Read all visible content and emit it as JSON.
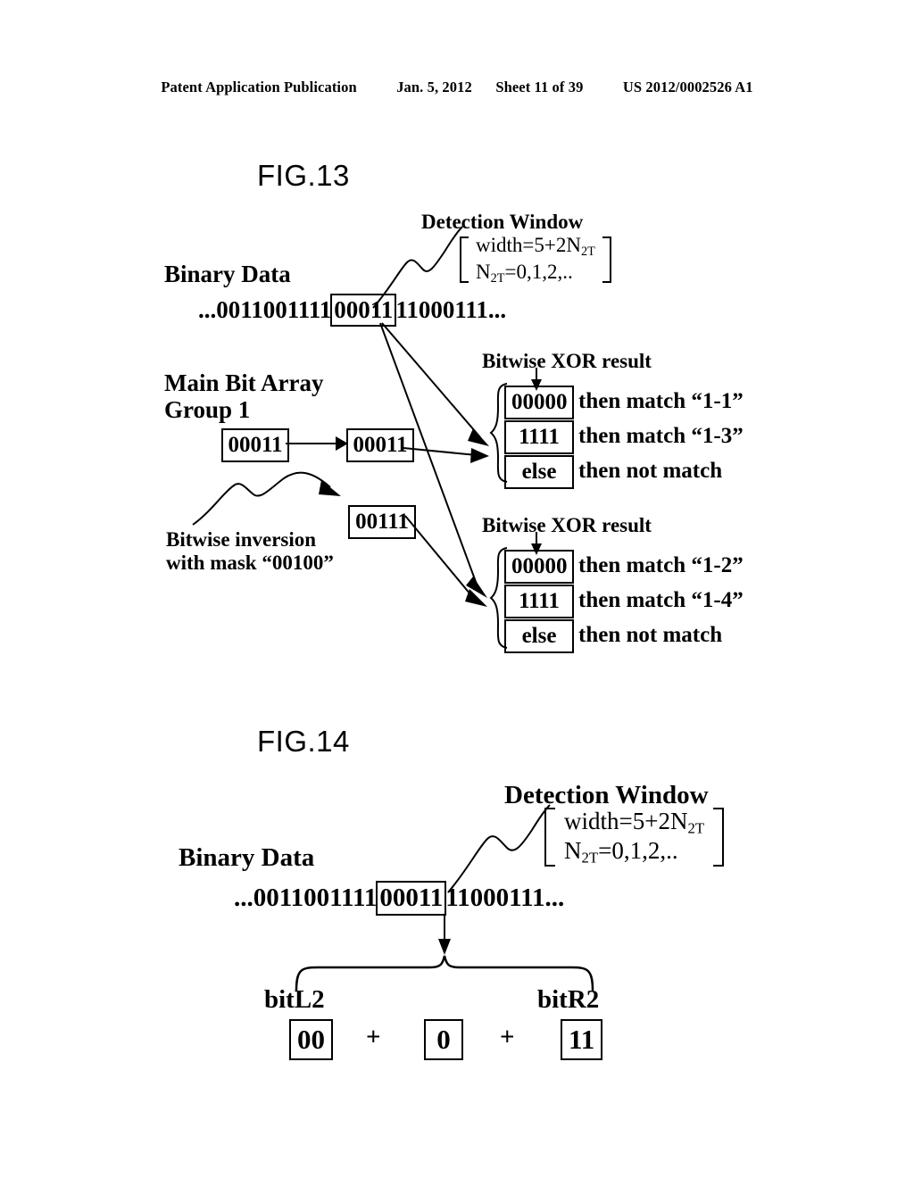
{
  "header": {
    "publication": "Patent Application Publication",
    "date": "Jan. 5, 2012",
    "sheet": "Sheet 11 of 39",
    "docnum": "US 2012/0002526 A1"
  },
  "fig13": {
    "title": "FIG.13",
    "detection_window": {
      "label": "Detection Window",
      "line1_prefix": "width=5+2N",
      "line1_sub": "2T",
      "line2_prefix": "N",
      "line2_sub": "2T",
      "line2_suffix": "=0,1,2,.."
    },
    "binary_data_label": "Binary Data",
    "binary_left": "...0011001111",
    "binary_window": "00011",
    "binary_right": "11000111...",
    "main_bit_array_line1": "Main Bit Array",
    "main_bit_array_line2": "Group 1",
    "source_box": "00011",
    "copy_box": "00011",
    "inverted_box": "00111",
    "inversion_note_line1": "Bitwise inversion",
    "inversion_note_line2": "with mask “00100”",
    "xor_label_top": "Bitwise XOR result",
    "xor_label_bottom": "Bitwise XOR result",
    "results_top": [
      {
        "value": "00000",
        "text": "then match “1-1”"
      },
      {
        "value": "1111",
        "text": "then match “1-3”"
      },
      {
        "value": "else",
        "text": "then not match"
      }
    ],
    "results_bottom": [
      {
        "value": "00000",
        "text": "then match “1-2”"
      },
      {
        "value": "1111",
        "text": "then match “1-4”"
      },
      {
        "value": "else",
        "text": "then not match"
      }
    ]
  },
  "fig14": {
    "title": "FIG.14",
    "detection_window": {
      "label": "Detection Window",
      "line1_prefix": "width=5+2N",
      "line1_sub": "2T",
      "line2_prefix": "N",
      "line2_sub": "2T",
      "line2_suffix": "=0,1,2,.."
    },
    "binary_data_label": "Binary Data",
    "binary_left": "...0011001111",
    "binary_window": "00011",
    "binary_right": "11000111...",
    "bitL2_label": "bitL2",
    "bitR2_label": "bitR2",
    "seg_left": "00",
    "plus1": "+",
    "seg_mid": "0",
    "plus2": "+",
    "seg_right": "11"
  }
}
